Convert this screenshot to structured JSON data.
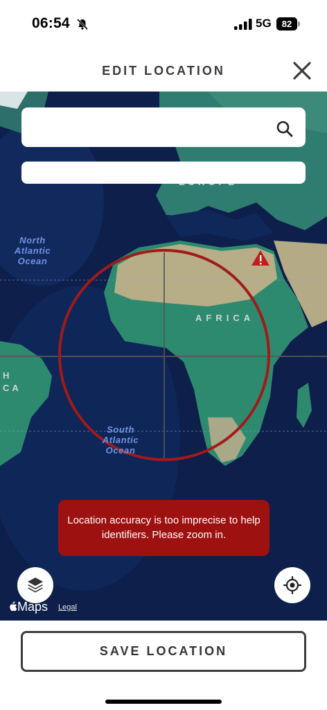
{
  "status_bar": {
    "time": "06:54",
    "network": "5G",
    "battery": "82",
    "icons": [
      "bell-slash-icon",
      "signal-icon",
      "battery-icon"
    ]
  },
  "header": {
    "title": "EDIT LOCATION",
    "close_icon": "close-icon"
  },
  "search": {
    "value": "",
    "placeholder": "",
    "icon": "search-icon"
  },
  "secondary_field": {
    "value": ""
  },
  "map": {
    "labels": {
      "north_atlantic": "North\nAtlantic\nOcean",
      "south_atlantic": "South\nAtlantic\nOcean",
      "africa": "AFRICA",
      "europe": "EUROPE",
      "america_partial": "H\nCA"
    },
    "warning_text": "Location accuracy is too imprecise to help identifiers. Please zoom in.",
    "attribution": "Maps",
    "legal": "Legal",
    "accuracy_circle_color": "#a11a1a",
    "icons": [
      "warning-triangle-icon",
      "layers-icon",
      "locate-icon",
      "apple-logo-icon"
    ]
  },
  "footer": {
    "save_label": "SAVE LOCATION"
  },
  "colors": {
    "ocean": "#0d1f4a",
    "land_green": "#2f8a72",
    "land_desert": "#b8ad88",
    "alert_red": "#9d1111"
  }
}
